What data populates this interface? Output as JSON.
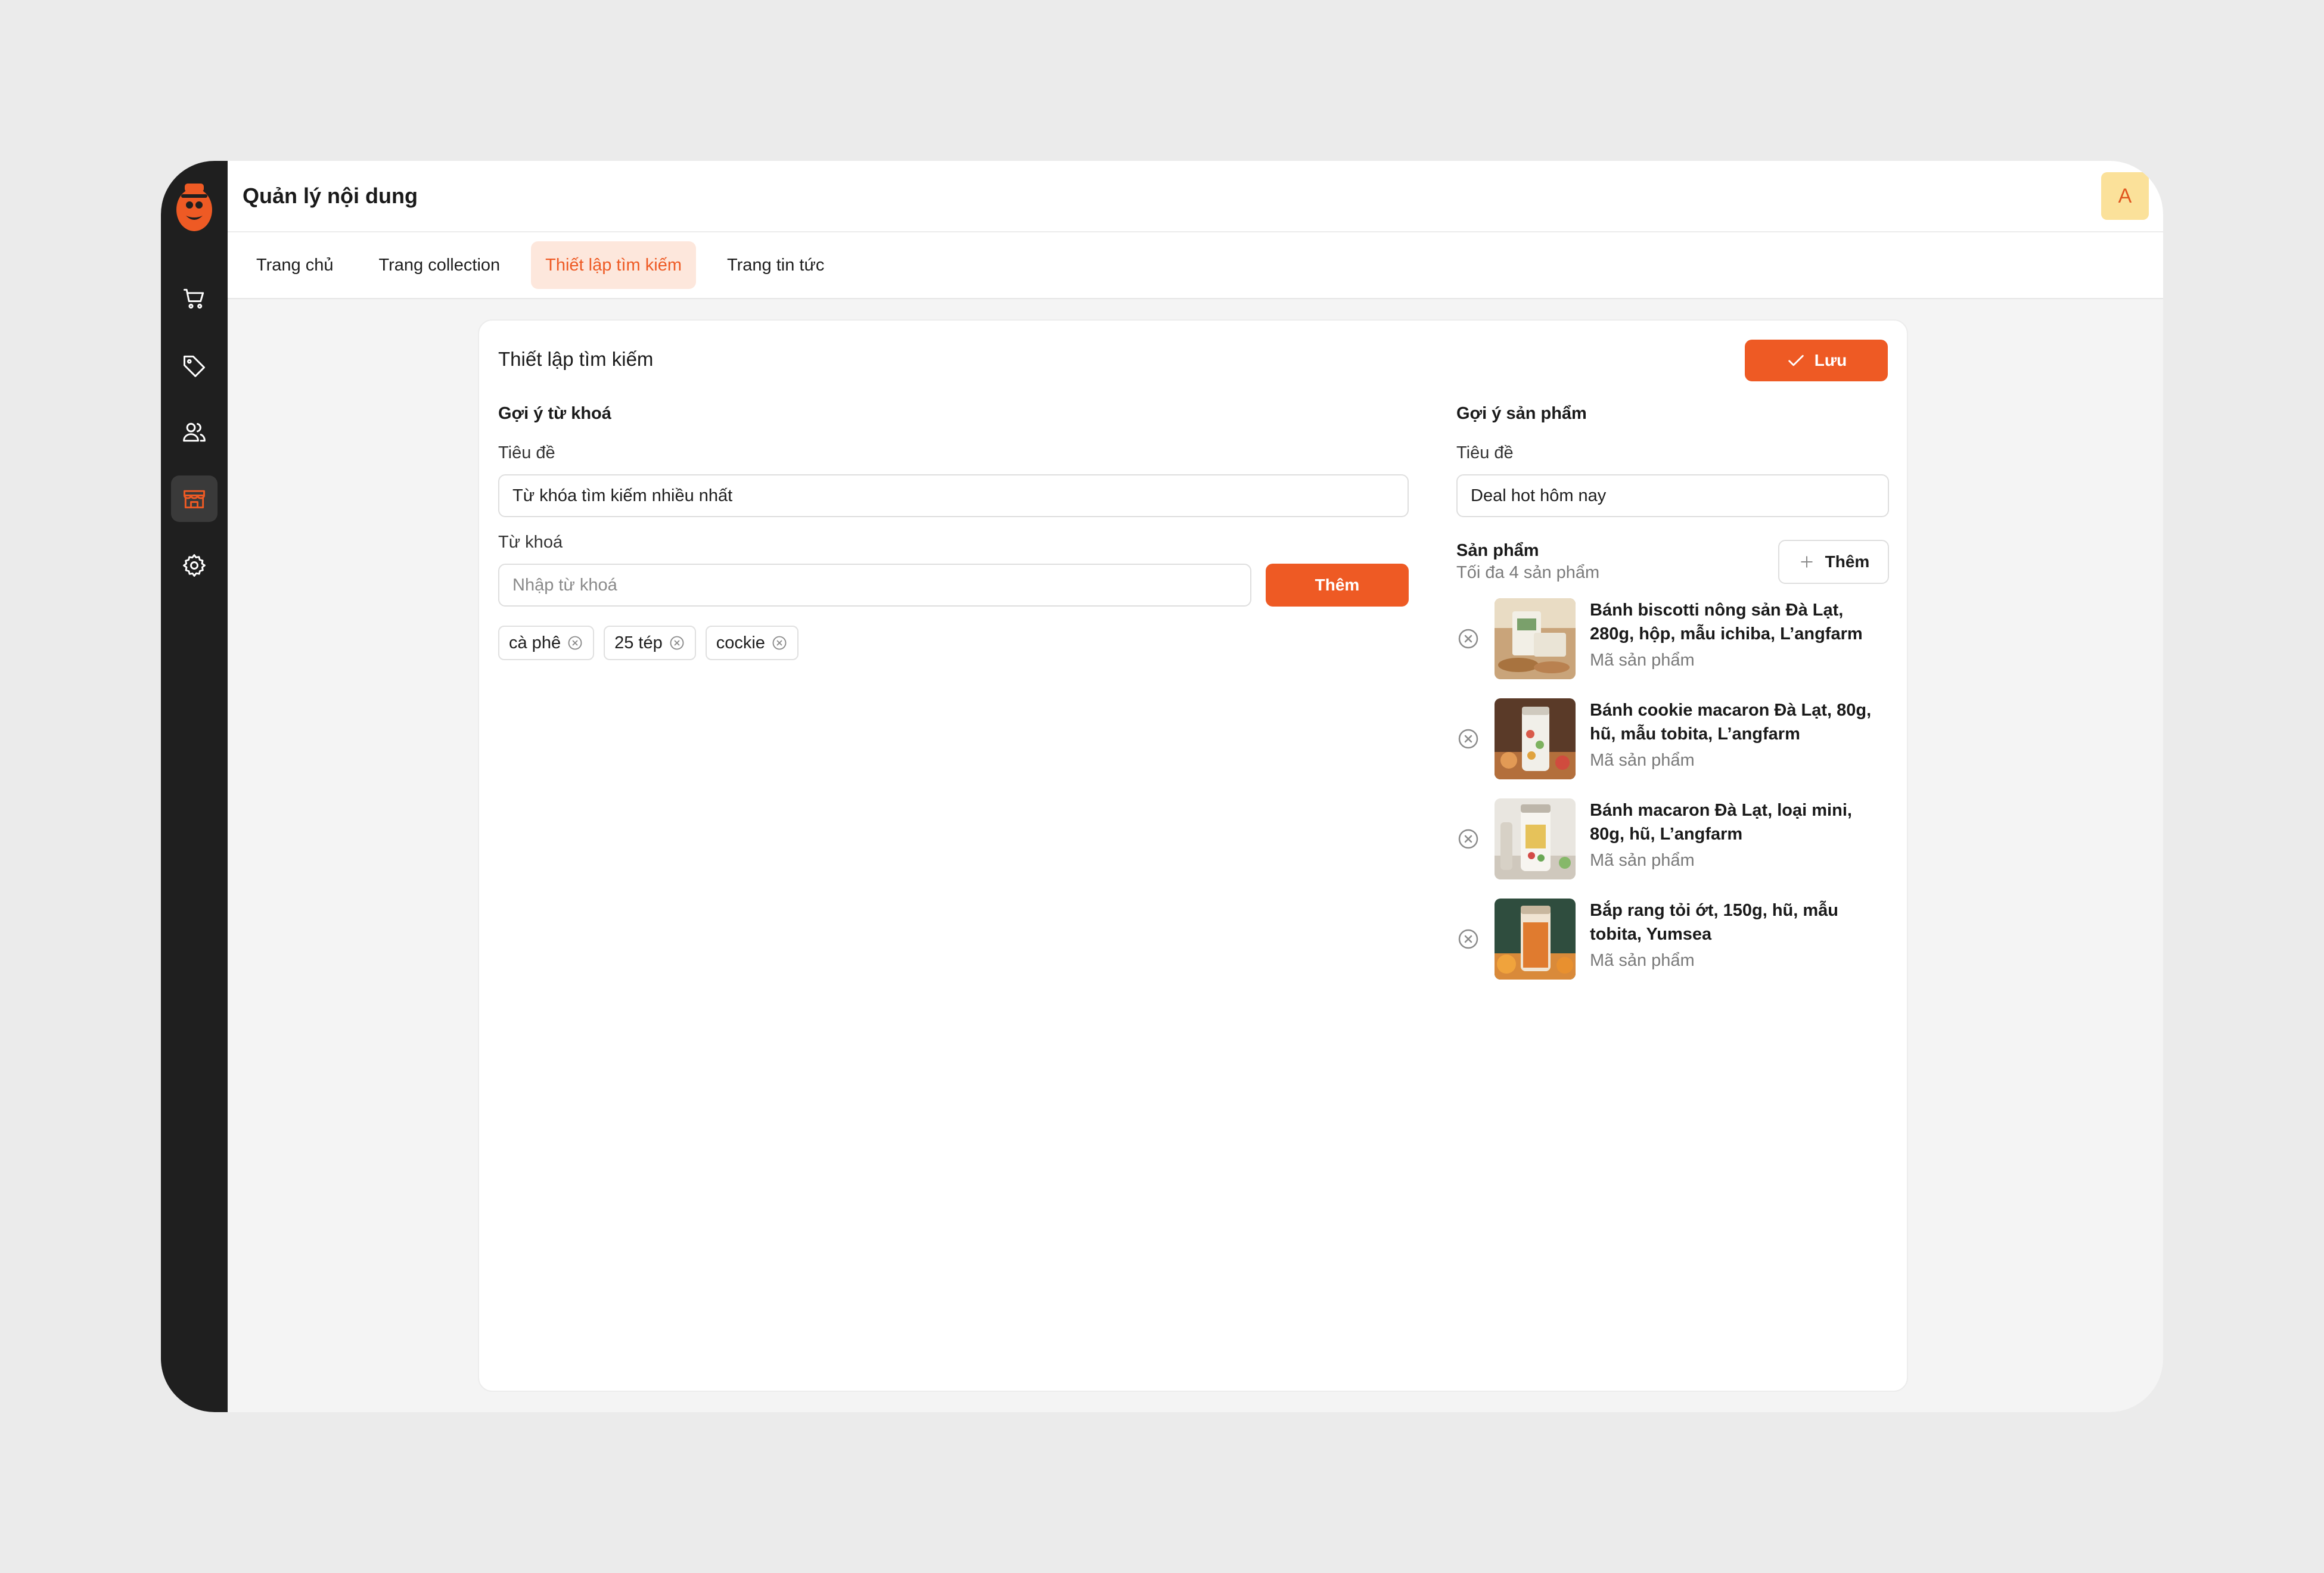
{
  "header": {
    "title": "Quản lý nội dung",
    "avatar_initial": "A"
  },
  "sidebar": {
    "items": [
      {
        "name": "cart-icon"
      },
      {
        "name": "tag-icon"
      },
      {
        "name": "users-icon"
      },
      {
        "name": "store-icon",
        "active": true
      },
      {
        "name": "gear-icon"
      }
    ]
  },
  "tabs": [
    {
      "label": "Trang chủ"
    },
    {
      "label": "Trang collection"
    },
    {
      "label": "Thiết lập tìm kiếm",
      "active": true
    },
    {
      "label": "Trang tin tức"
    }
  ],
  "card": {
    "title": "Thiết lập tìm kiếm",
    "save_label": "Lưu"
  },
  "keyword_section": {
    "title": "Gợi ý từ khoá",
    "heading_label": "Tiêu đề",
    "heading_value": "Từ khóa tìm kiếm nhiều nhất",
    "keyword_label": "Từ khoá",
    "keyword_placeholder": "Nhập từ khoá",
    "add_label": "Thêm",
    "tags": [
      "cà phê",
      "25 tép",
      "cockie"
    ]
  },
  "product_section": {
    "title": "Gợi ý sản phẩm",
    "heading_label": "Tiêu đề",
    "heading_value": "Deal hot hôm nay",
    "products_label": "Sản phẩm",
    "products_hint": "Tối đa 4 sản phẩm",
    "add_label": "Thêm",
    "products": [
      {
        "name_line1": "Bánh biscotti nông sản Đà Lạt,",
        "name_line2": "280g, hộp, mẫu ichiba, L’angfarm",
        "code": "Mã sản phẩm"
      },
      {
        "name_line1": "Bánh cookie macaron Đà Lạt, 80g,",
        "name_line2": "hũ, mẫu tobita, L’angfarm",
        "code": "Mã sản phẩm"
      },
      {
        "name_line1": "Bánh macaron Đà Lạt, loại mini,",
        "name_line2": "80g, hũ, L’angfarm",
        "code": "Mã sản phẩm"
      },
      {
        "name_line1": "Bắp rang tỏi ớt, 150g, hũ, mẫu",
        "name_line2": "tobita, Yumsea",
        "code": "Mã sản phẩm"
      }
    ]
  },
  "colors": {
    "accent": "#ee5a24",
    "sidebar_bg": "#1f1f1f",
    "tab_active_bg": "#fde7dc",
    "avatar_bg": "#fbe19a"
  }
}
